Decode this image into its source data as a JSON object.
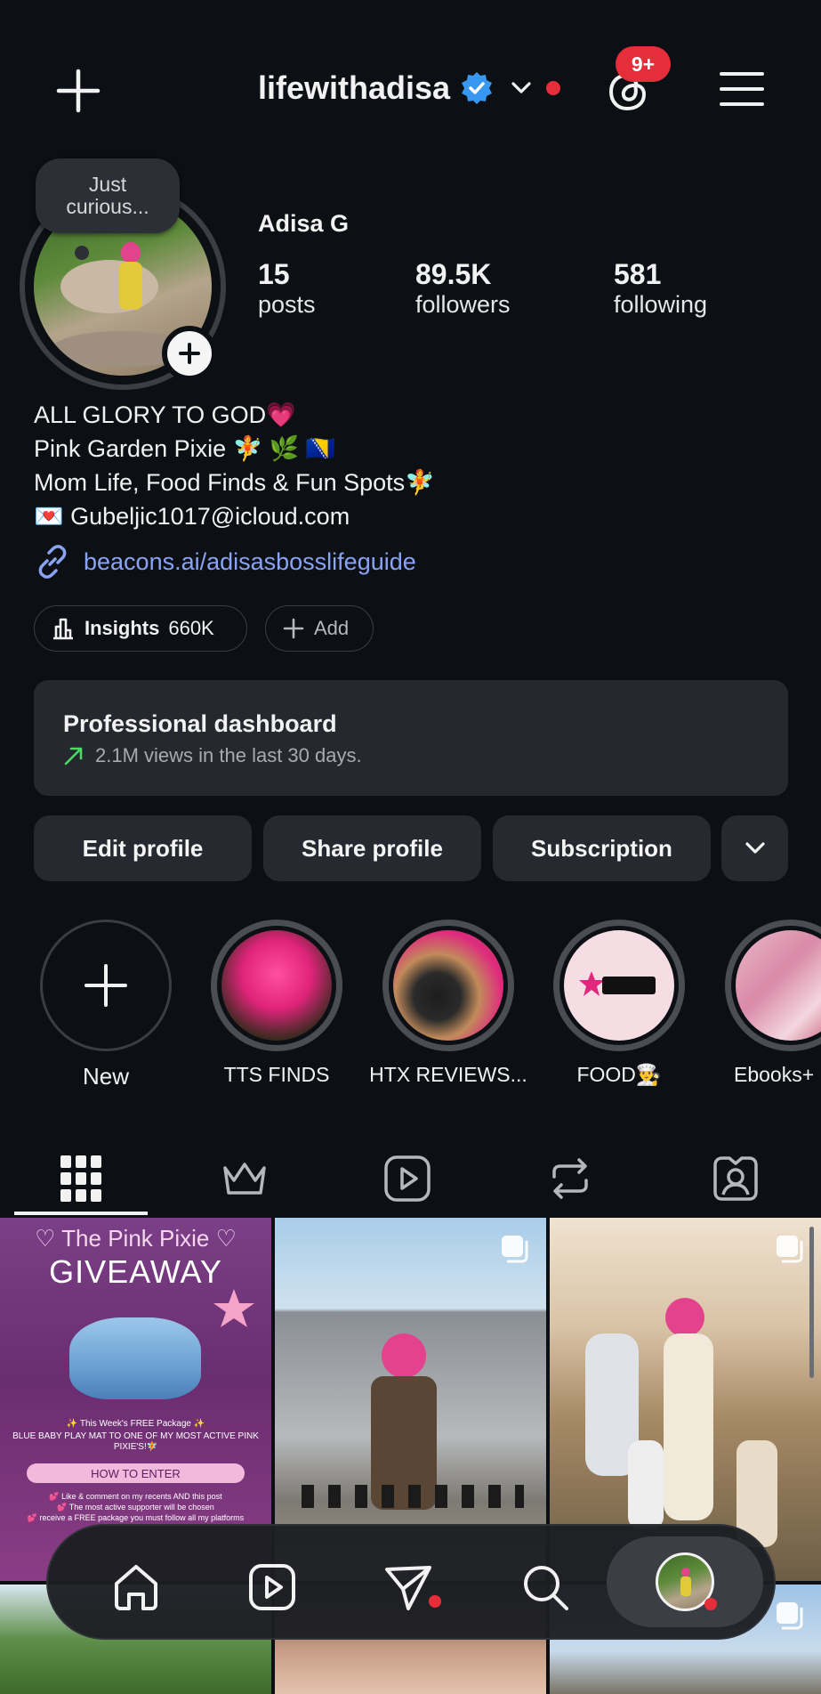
{
  "header": {
    "username": "lifewithadisa",
    "notification_badge": "9+",
    "badge_color": "#e52e3a",
    "verified_color": "#3897f0",
    "icons": [
      "plus-icon",
      "verified-icon",
      "chevron-down-icon",
      "threads-icon",
      "menu-icon"
    ]
  },
  "profile": {
    "note_text": "Just curious...",
    "display_name": "Adisa G",
    "stats": {
      "posts_count": "15",
      "posts_label": "posts",
      "followers_count": "89.5K",
      "followers_label": "followers",
      "following_count": "581",
      "following_label": "following"
    },
    "bio": [
      "ALL GLORY TO GOD💗",
      "Pink Garden Pixie 🧚 🌿 🇧🇦",
      "Mom Life, Food Finds & Fun Spots🧚",
      "💌 Gubeljic1017@icloud.com"
    ],
    "link": "beacons.ai/adisasbosslifeguide",
    "link_color": "#8aa4f5"
  },
  "chips": {
    "insights_label": "Insights",
    "insights_value": "660K",
    "add_label": "Add"
  },
  "dashboard": {
    "title": "Professional dashboard",
    "subtitle": "2.1M views in the last 30 days.",
    "trend_color": "#4cd964"
  },
  "actions": {
    "edit": "Edit profile",
    "share": "Share profile",
    "subscription": "Subscription"
  },
  "highlights": [
    {
      "label": "New"
    },
    {
      "label": "TTS FINDS"
    },
    {
      "label": "HTX REVIEWS..."
    },
    {
      "label": "FOOD👨‍🍳"
    },
    {
      "label": "Ebooks+"
    }
  ],
  "tabs": [
    "grid-icon",
    "crown-icon",
    "reels-icon",
    "reposts-icon",
    "tagged-icon"
  ],
  "posts": {
    "giveaway": {
      "header": "♡ The Pink Pixie ♡",
      "title": "GIVEAWAY",
      "line1": "✨ This Week's FREE Package ✨",
      "line2": "BLUE BABY PLAY MAT TO ONE OF MY MOST ACTIVE PINK PIXIE'S!🧚",
      "button": "HOW TO ENTER",
      "foot1": "💕 Like & comment on my recents AND this post",
      "foot2": "💕 The most active supporter will be chosen",
      "foot3": "💕 receive a FREE package you must follow all my platforms"
    }
  },
  "bottom_nav": [
    "home-icon",
    "reels-icon",
    "direct-message-icon",
    "search-icon",
    "profile-avatar"
  ]
}
